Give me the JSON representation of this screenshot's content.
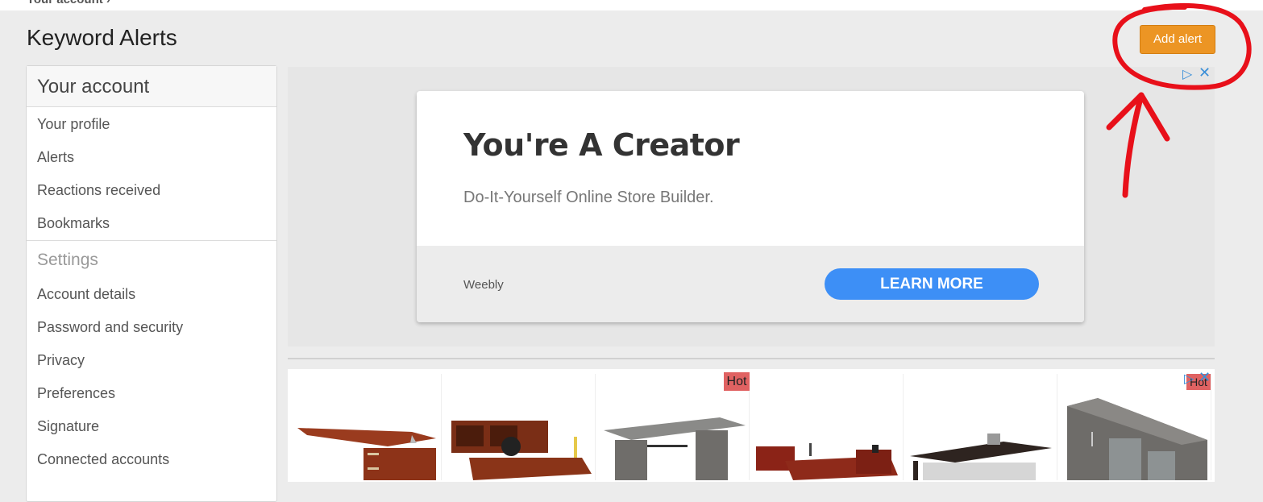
{
  "header": {
    "breadcrumb": "Your account",
    "breadcrumb_chevron": "›",
    "title": "Keyword Alerts",
    "add_alert_label": "Add alert",
    "accent_color": "#ec9524"
  },
  "sidebar": {
    "heading": "Your account",
    "items": [
      "Your profile",
      "Alerts",
      "Reactions received",
      "Bookmarks"
    ],
    "settings_heading": "Settings",
    "settings_items": [
      "Account details",
      "Password and security",
      "Privacy",
      "Preferences",
      "Signature",
      "Connected accounts"
    ]
  },
  "ad_banner": {
    "headline": "You're A Creator",
    "description": "Do-It-Yourself Online Store Builder.",
    "brand": "Weebly",
    "cta": "LEARN MORE",
    "cta_color": "#3d8ff6"
  },
  "ad_products": {
    "badge": "Hot",
    "adchoices_icon": "▷",
    "close_icon": "✕"
  },
  "annotation": {
    "color": "#e8101a",
    "type": "hand-drawn circle and arrow pointing at Add alert button"
  }
}
